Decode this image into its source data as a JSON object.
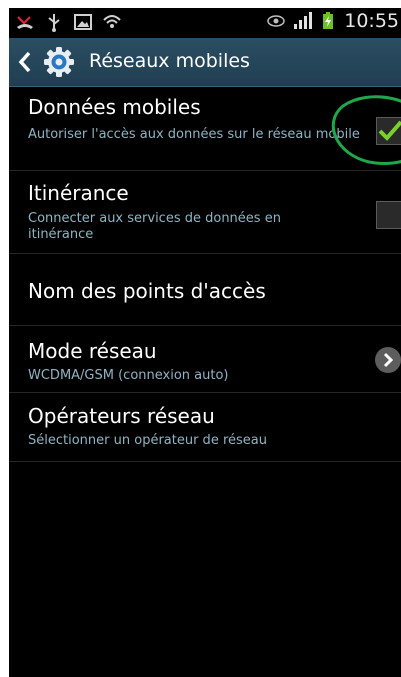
{
  "status_bar": {
    "time": "10:55",
    "left_icons": [
      "missed-call-icon",
      "usb-icon",
      "image-icon",
      "wifi-hotspot-icon"
    ],
    "right_icons": [
      "eye-icon",
      "signal-icon",
      "battery-charging-icon"
    ]
  },
  "action_bar": {
    "title": "Réseaux mobiles",
    "back_icon": "chevron-left-icon",
    "app_icon": "gear-icon",
    "color": "#244559"
  },
  "settings": {
    "mobile_data": {
      "title": "Données mobiles",
      "subtitle": "Autoriser l'accès aux données sur le réseau mobile",
      "checked": true
    },
    "roaming": {
      "title": "Itinérance",
      "subtitle": "Connecter aux services de données en itinérance",
      "checked": false
    },
    "apn": {
      "title": "Nom des points d'accès"
    },
    "network_mode": {
      "title": "Mode réseau",
      "subtitle": "WCDMA/GSM (connexion auto)"
    },
    "operators": {
      "title": "Opérateurs réseau",
      "subtitle": "Sélectionner un opérateur de réseau"
    }
  },
  "colors": {
    "subtitle": "#8fb4c4",
    "check": "#7ad12a",
    "annotation_circle": "#1fa84a"
  }
}
